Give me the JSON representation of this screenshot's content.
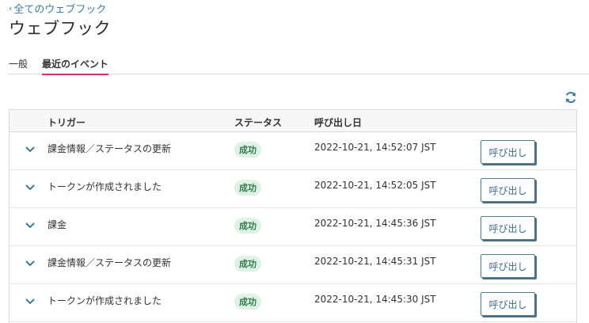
{
  "nav": {
    "back_label": "全てのウェブフック"
  },
  "page": {
    "title": "ウェブフック"
  },
  "tabs": [
    {
      "label": "一般",
      "active": false
    },
    {
      "label": "最近のイベント",
      "active": true
    }
  ],
  "colors": {
    "accent": "#d6336c",
    "link": "#3a7ca5",
    "success_bg": "#dff2e4",
    "success_text": "#2e7d4f"
  },
  "events": {
    "refresh_icon": "refresh-icon",
    "columns": {
      "trigger": "トリガー",
      "status": "ステータス",
      "called_at": "呼び出し日"
    },
    "rows": [
      {
        "trigger": "課金情報／ステータスの更新",
        "status": "成功",
        "date": "2022-10-21, 14:52:07 JST",
        "action": "呼び出し"
      },
      {
        "trigger": "トークンが作成されました",
        "status": "成功",
        "date": "2022-10-21, 14:52:05 JST",
        "action": "呼び出し"
      },
      {
        "trigger": "課金",
        "status": "成功",
        "date": "2022-10-21, 14:45:36 JST",
        "action": "呼び出し"
      },
      {
        "trigger": "課金情報／ステータスの更新",
        "status": "成功",
        "date": "2022-10-21, 14:45:31 JST",
        "action": "呼び出し"
      },
      {
        "trigger": "トークンが作成されました",
        "status": "成功",
        "date": "2022-10-21, 14:45:30 JST",
        "action": "呼び出し"
      }
    ]
  }
}
